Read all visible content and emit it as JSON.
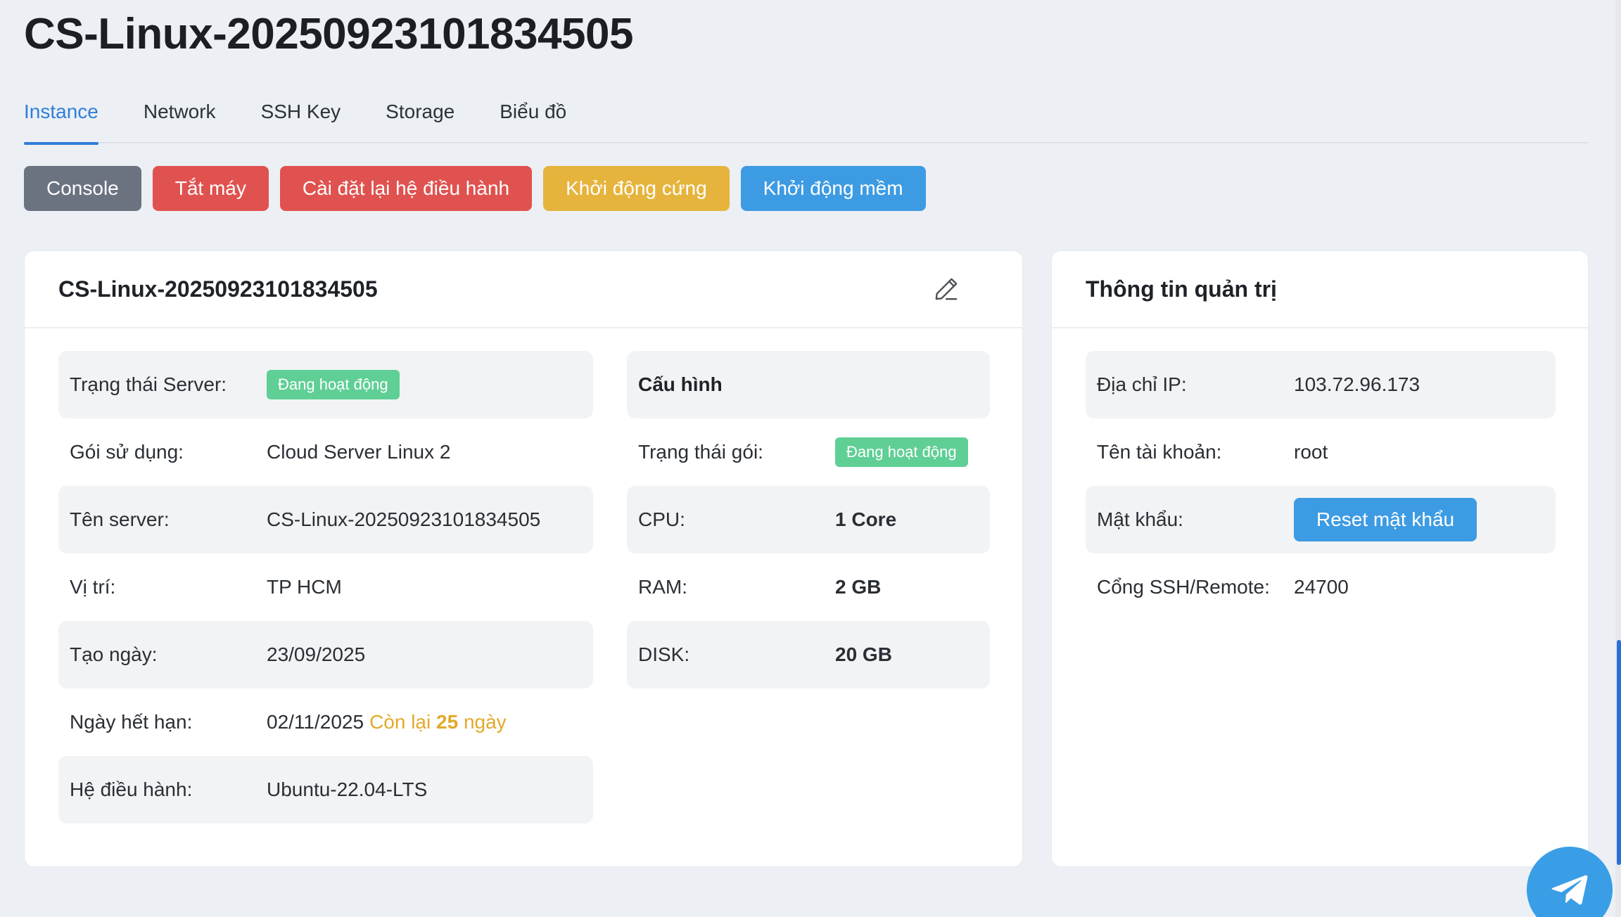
{
  "page": {
    "title": "CS-Linux-20250923101834505"
  },
  "tabs": [
    {
      "label": "Instance",
      "active": true
    },
    {
      "label": "Network"
    },
    {
      "label": "SSH Key"
    },
    {
      "label": "Storage"
    },
    {
      "label": "Biểu đồ"
    }
  ],
  "actions": {
    "console": "Console",
    "shutdown": "Tắt máy",
    "reinstall": "Cài đặt lại hệ điều hành",
    "hard_reboot": "Khởi động cứng",
    "soft_reboot": "Khởi động mềm"
  },
  "server_card": {
    "title": "CS-Linux-20250923101834505",
    "rows": {
      "status": {
        "label": "Trạng thái Server:",
        "value": "Đang hoạt động"
      },
      "package": {
        "label": "Gói sử dụng:",
        "value": "Cloud Server Linux 2"
      },
      "name": {
        "label": "Tên server:",
        "value": "CS-Linux-20250923101834505"
      },
      "location": {
        "label": "Vị trí:",
        "value": "TP HCM"
      },
      "created": {
        "label": "Tạo ngày:",
        "value": "23/09/2025"
      },
      "expiry": {
        "label": "Ngày hết hạn:",
        "value": "02/11/2025",
        "remain_prefix": "Còn lại",
        "remain_days": "25",
        "remain_suffix": "ngày"
      },
      "os": {
        "label": "Hệ điều hành:",
        "value": "Ubuntu-22.04-LTS"
      }
    },
    "config": {
      "heading": "Cấu hình",
      "package_status": {
        "label": "Trạng thái gói:",
        "value": "Đang hoạt động"
      },
      "cpu": {
        "label": "CPU:",
        "value": "1 Core"
      },
      "ram": {
        "label": "RAM:",
        "value": "2 GB"
      },
      "disk": {
        "label": "DISK:",
        "value": "20 GB"
      }
    }
  },
  "admin_card": {
    "title": "Thông tin quản trị",
    "ip": {
      "label": "Địa chỉ IP:",
      "value": "103.72.96.173"
    },
    "account": {
      "label": "Tên tài khoản:",
      "value": "root"
    },
    "password": {
      "label": "Mật khẩu:",
      "button": "Reset mật khẩu"
    },
    "port": {
      "label": "Cổng SSH/Remote:",
      "value": "24700"
    }
  },
  "colors": {
    "accent": "#2f7fd8",
    "badge_green": "#5fcf95",
    "warning": "#e3a92a",
    "danger": "#e0524f",
    "info": "#3d9be3",
    "neutral": "#6b7280"
  }
}
